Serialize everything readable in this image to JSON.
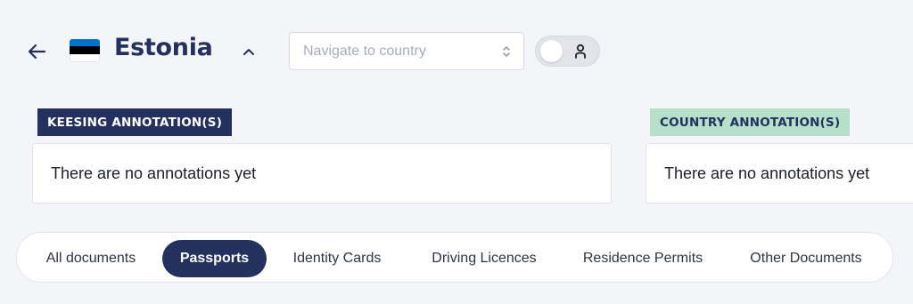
{
  "header": {
    "back_icon": "arrow-left-icon",
    "country": "Estonia",
    "flag_colors": [
      "#0072ce",
      "#000000",
      "#ffffff"
    ],
    "collapse_icon": "chevron-up-icon",
    "navigate_placeholder": "Navigate to country",
    "toggle": {
      "state": "off",
      "icon": "person-icon"
    }
  },
  "annotations": {
    "keesing": {
      "label": "KEESING ANNOTATION(S)",
      "text": "There are no annotations yet",
      "color": "#24305e"
    },
    "country": {
      "label": "COUNTRY ANNOTATION(S)",
      "text": "There are no annotations yet",
      "color": "#b6e0c9"
    }
  },
  "tabs": [
    {
      "label": "All documents",
      "active": false
    },
    {
      "label": "Passports",
      "active": true
    },
    {
      "label": "Identity Cards",
      "active": false
    },
    {
      "label": "Driving Licences",
      "active": false
    },
    {
      "label": "Residence Permits",
      "active": false
    },
    {
      "label": "Other Documents",
      "active": false
    }
  ],
  "theme": {
    "primary": "#24305e",
    "background": "#f4f5f8"
  }
}
